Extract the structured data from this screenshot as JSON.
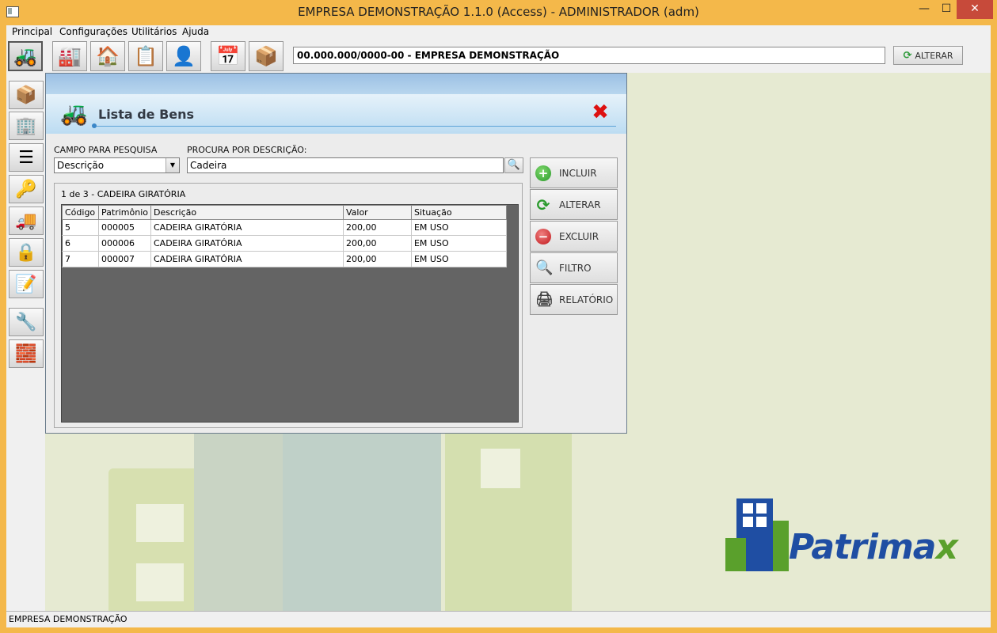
{
  "window": {
    "title": "EMPRESA DEMONSTRAÇÃO 1.1.0 (Access) - ADMINISTRADOR (adm)",
    "minimize_glyph": "—",
    "maximize_glyph": "☐",
    "close_glyph": "✕"
  },
  "menu": {
    "items": [
      "Principal",
      "Configurações",
      "Utilitários",
      "Ajuda"
    ]
  },
  "toolbar": {
    "buttons": [
      "forklift-icon",
      "warehouse-icon",
      "house-icon",
      "clipboard-icon",
      "user-icon",
      "calendar-icon",
      "box-icon"
    ],
    "company_field": "00.000.000/0000-00 - EMPRESA DEMONSTRAÇÃO",
    "alterar_label": "ALTERAR"
  },
  "sidebar": {
    "buttons": [
      "box-icon",
      "org-chart-icon",
      "tree-list-icon",
      "key-icon",
      "truck-icon",
      "lock-icon",
      "document-pen-icon",
      "tools-icon",
      "brick-wall-icon"
    ]
  },
  "dialog": {
    "title": "Lista de Bens",
    "campo_label": "CAMPO PARA PESQUISA",
    "campo_value": "Descrição",
    "procura_label": "PROCURA POR DESCRIÇÃO:",
    "procura_value": "Cadeira",
    "grid_caption": "1 de 3 - CADEIRA GIRATÓRIA",
    "columns": [
      "Código",
      "Patrimônio",
      "Descrição",
      "Valor",
      "Situação"
    ],
    "rows": [
      [
        "5",
        "000005",
        "CADEIRA GIRATÓRIA",
        "200,00",
        "EM USO"
      ],
      [
        "6",
        "000006",
        "CADEIRA GIRATÓRIA",
        "200,00",
        "EM USO"
      ],
      [
        "7",
        "000007",
        "CADEIRA GIRATÓRIA",
        "200,00",
        "EM USO"
      ]
    ],
    "actions": {
      "incluir": "INCLUIR",
      "alterar": "ALTERAR",
      "excluir": "EXCLUIR",
      "filtro": "FILTRO",
      "relatorio": "RELATÓRIO"
    }
  },
  "logo": {
    "text_main": "Patrima",
    "text_accent": "x"
  },
  "status": {
    "text": "EMPRESA DEMONSTRAÇÃO"
  },
  "colors": {
    "window_frame": "#f4b84a",
    "accent_blue": "#1f4ea3",
    "accent_green": "#5aa02c",
    "close_red": "#d11111"
  }
}
